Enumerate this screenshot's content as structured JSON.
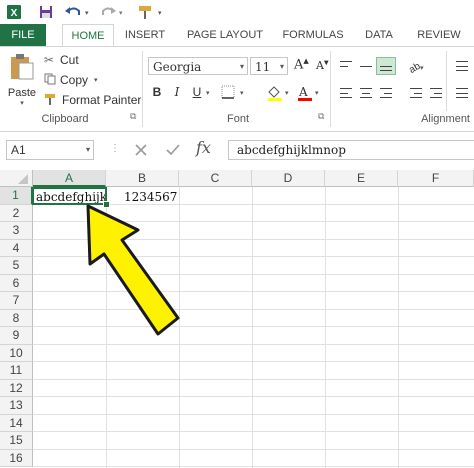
{
  "app": {
    "name": "Excel",
    "accent": "#217346"
  },
  "qat": {
    "icons": [
      "excel-logo-icon",
      "save-icon",
      "undo-icon",
      "redo-icon",
      "format-painter-icon"
    ]
  },
  "tabs": [
    {
      "label": "FILE"
    },
    {
      "label": "HOME"
    },
    {
      "label": "INSERT"
    },
    {
      "label": "PAGE LAYOUT"
    },
    {
      "label": "FORMULAS"
    },
    {
      "label": "DATA"
    },
    {
      "label": "REVIEW"
    }
  ],
  "clipboard": {
    "paste": "Paste",
    "cut": "Cut",
    "copy": "Copy",
    "format_painter": "Format Painter",
    "label": "Clipboard"
  },
  "font": {
    "name": "Georgia",
    "size": "11",
    "label": "Font",
    "bold": "B",
    "italic": "I",
    "underline": "U",
    "grow": "A",
    "shrink": "A",
    "font_color": "A",
    "fill_color": "#ffff00",
    "font_color_value": "#ff0000"
  },
  "alignment": {
    "label": "Alignment"
  },
  "formula_bar": {
    "name_box": "A1",
    "fx": "fx",
    "content": "abcdefghijklmnop"
  },
  "sheet": {
    "columns": [
      "A",
      "B",
      "C",
      "D",
      "E",
      "F"
    ],
    "rows": [
      "1",
      "2",
      "3",
      "4",
      "5",
      "6",
      "7",
      "8",
      "9",
      "10",
      "11",
      "12",
      "13",
      "14",
      "15",
      "16"
    ],
    "cells": {
      "A1": "abcdefghijk",
      "B1": "1234567"
    },
    "active_cell": "A1"
  },
  "annotation": {
    "arrow_color": "#fff200",
    "arrow_outline": "#1a1a1a"
  }
}
